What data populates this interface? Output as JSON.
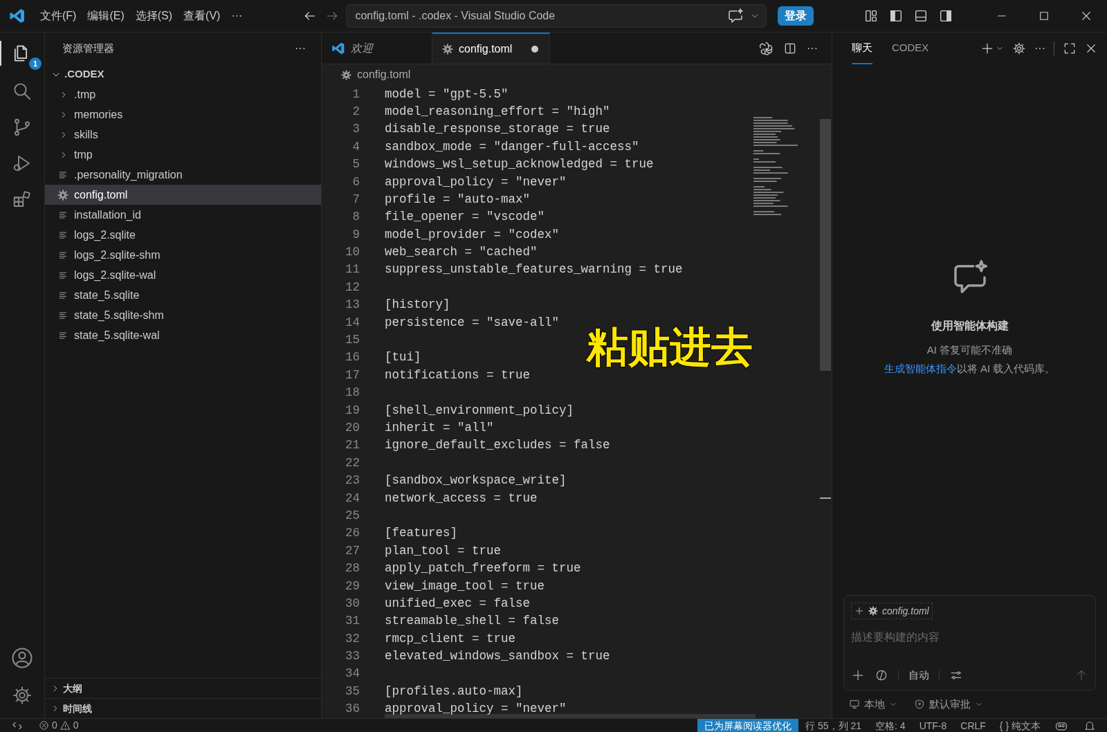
{
  "title_bar": {
    "menus": [
      "文件(F)",
      "编辑(E)",
      "选择(S)",
      "查看(V)",
      "···"
    ],
    "command_center": "config.toml - .codex - Visual Studio Code",
    "login_button": "登录"
  },
  "activity_bar": {
    "explorer_badge": "1"
  },
  "sidebar": {
    "title": "资源管理器",
    "more": "···",
    "root": {
      "label": ".CODEX",
      "expanded": true
    },
    "items": [
      {
        "label": ".tmp",
        "kind": "folder",
        "selected": false
      },
      {
        "label": "memories",
        "kind": "folder",
        "selected": false
      },
      {
        "label": "skills",
        "kind": "folder",
        "selected": false
      },
      {
        "label": "tmp",
        "kind": "folder",
        "selected": false
      },
      {
        "label": ".personality_migration",
        "kind": "file",
        "selected": false
      },
      {
        "label": "config.toml",
        "kind": "settings",
        "selected": true
      },
      {
        "label": "installation_id",
        "kind": "file",
        "selected": false
      },
      {
        "label": "logs_2.sqlite",
        "kind": "file",
        "selected": false
      },
      {
        "label": "logs_2.sqlite-shm",
        "kind": "file",
        "selected": false
      },
      {
        "label": "logs_2.sqlite-wal",
        "kind": "file",
        "selected": false
      },
      {
        "label": "state_5.sqlite",
        "kind": "file",
        "selected": false
      },
      {
        "label": "state_5.sqlite-shm",
        "kind": "file",
        "selected": false
      },
      {
        "label": "state_5.sqlite-wal",
        "kind": "file",
        "selected": false
      }
    ],
    "sections": [
      {
        "label": "大纲",
        "expanded": false
      },
      {
        "label": "时间线",
        "expanded": false
      }
    ]
  },
  "editor": {
    "tabs": [
      {
        "label": "欢迎",
        "kind": "welcome",
        "selected": false,
        "dirty": false
      },
      {
        "label": "config.toml",
        "kind": "settings",
        "selected": true,
        "dirty": true
      }
    ],
    "more": "···",
    "breadcrumb": "config.toml",
    "lines": [
      {
        "number": "1",
        "text": "model = \"gpt-5.5\""
      },
      {
        "number": "2",
        "text": "model_reasoning_effort = \"high\""
      },
      {
        "number": "3",
        "text": "disable_response_storage = true"
      },
      {
        "number": "4",
        "text": "sandbox_mode = \"danger-full-access\""
      },
      {
        "number": "5",
        "text": "windows_wsl_setup_acknowledged = true"
      },
      {
        "number": "6",
        "text": "approval_policy = \"never\""
      },
      {
        "number": "7",
        "text": "profile = \"auto-max\""
      },
      {
        "number": "8",
        "text": "file_opener = \"vscode\""
      },
      {
        "number": "9",
        "text": "model_provider = \"codex\""
      },
      {
        "number": "10",
        "text": "web_search = \"cached\""
      },
      {
        "number": "11",
        "text": "suppress_unstable_features_warning = true"
      },
      {
        "number": "12"
      },
      {
        "number": "13",
        "text": "[history]"
      },
      {
        "number": "14",
        "text": "persistence = \"save-all\""
      },
      {
        "number": "15"
      },
      {
        "number": "16",
        "text": "[tui]"
      },
      {
        "number": "17",
        "text": "notifications = true"
      },
      {
        "number": "18"
      },
      {
        "number": "19",
        "text": "[shell_environment_policy]"
      },
      {
        "number": "20",
        "text": "inherit = \"all\""
      },
      {
        "number": "21",
        "text": "ignore_default_excludes = false"
      },
      {
        "number": "22"
      },
      {
        "number": "23",
        "text": "[sandbox_workspace_write]"
      },
      {
        "number": "24",
        "text": "network_access = true"
      },
      {
        "number": "25"
      },
      {
        "number": "26",
        "text": "[features]"
      },
      {
        "number": "27",
        "text": "plan_tool = true"
      },
      {
        "number": "28",
        "text": "apply_patch_freeform = true"
      },
      {
        "number": "29",
        "text": "view_image_tool = true"
      },
      {
        "number": "30",
        "text": "unified_exec = false"
      },
      {
        "number": "31",
        "text": "streamable_shell = false"
      },
      {
        "number": "32",
        "text": "rmcp_client = true"
      },
      {
        "number": "33",
        "text": "elevated_windows_sandbox = true"
      },
      {
        "number": "34"
      },
      {
        "number": "35",
        "text": "[profiles.auto-max]"
      },
      {
        "number": "36",
        "text": "approval_policy = \"never\""
      }
    ]
  },
  "overlay_caption": "粘贴进去",
  "chat": {
    "tabs": [
      {
        "label": "聊天",
        "selected": true
      },
      {
        "label": "CODEX",
        "selected": false
      }
    ],
    "more": "···",
    "heading": "使用智能体构建",
    "note": "AI 答复可能不准确",
    "link": "生成智能体指令",
    "link_suffix": "以将 AI 载入代码库。",
    "context_chip": "config.toml",
    "placeholder": "描述要构建的内容",
    "mode": "自动",
    "footer": [
      "本地",
      "默认审批"
    ]
  },
  "status_bar": {
    "errors": "0",
    "warnings": "0",
    "items": [
      "已为屏幕阅读器优化",
      "行 55，列 21",
      "空格: 4",
      "UTF-8",
      "CRLF",
      "{ } 纯文本"
    ]
  }
}
